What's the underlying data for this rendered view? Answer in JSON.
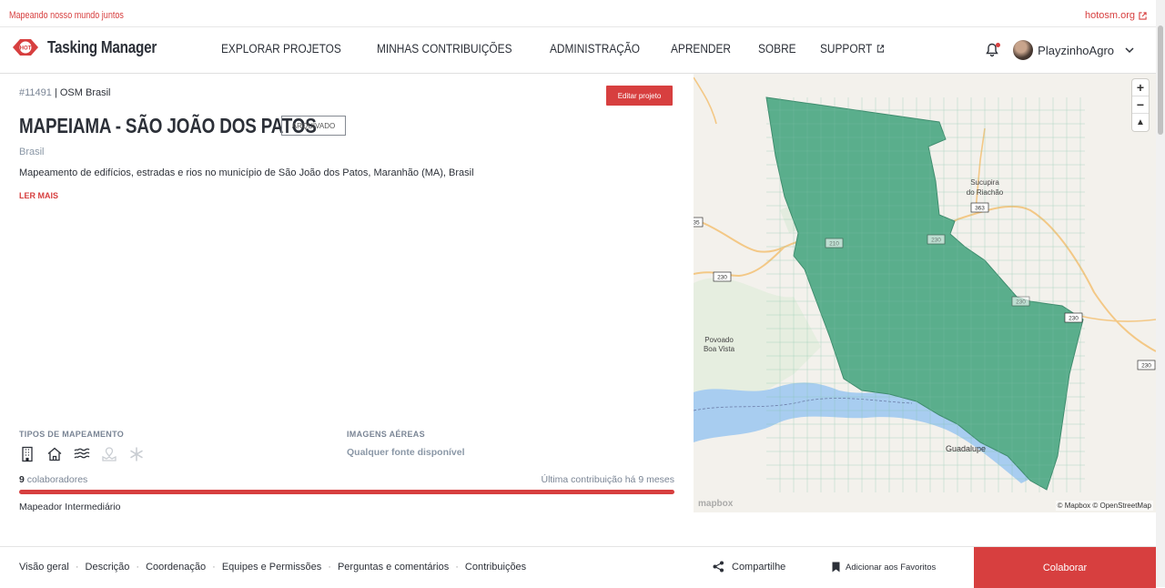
{
  "topbar": {
    "tagline": "Mapeando nosso mundo juntos",
    "org_link": "hotosm.org"
  },
  "header": {
    "logo_text": "Tasking Manager",
    "logo_badge": "HOT",
    "nav": [
      {
        "label": "EXPLORAR PROJETOS"
      },
      {
        "label": "MINHAS CONTRIBUIÇÕES"
      },
      {
        "label": "ADMINISTRAÇÃO"
      },
      {
        "label": "APRENDER"
      },
      {
        "label": "SOBRE"
      },
      {
        "label": "SUPPORT"
      }
    ],
    "username": "PlayzinhoAgro"
  },
  "project": {
    "id": "#11491",
    "org": "| OSM Brasil",
    "edit_label": "Editar projeto",
    "title": "MAPEIAMA - SÃO JOÃO DOS PATOS",
    "status_badge": "ARQUIVADO",
    "country": "Brasil",
    "description": "Mapeamento de edifícios, estradas e rios no município de São João dos Patos, Maranhão (MA), Brasil",
    "read_more": "LER MAIS",
    "types_label": "TIPOS DE MAPEAMENTO",
    "types_icons": [
      "buildings-icon",
      "house-icon",
      "waterways-icon",
      "land-use-icon",
      "other-icon"
    ],
    "imagery_label": "IMAGENS AÉREAS",
    "imagery_value": "Qualquer fonte disponível",
    "contributors_count": "9",
    "contributors_label": " colaboradores",
    "last_contribution": "Última contribuição há 9 meses",
    "level": "Mapeador Intermediário"
  },
  "map": {
    "places": [
      {
        "label": "Sucupira"
      },
      {
        "label": "do Riachão"
      },
      {
        "label": "Povoado"
      },
      {
        "label": "Boa Vista"
      },
      {
        "label": "Guadalupe"
      }
    ],
    "shields": [
      "363",
      "230",
      "230",
      "230",
      "230",
      "210",
      "230",
      "35"
    ],
    "attribution": "© Mapbox © OpenStreetMap",
    "logo": "mapbox",
    "zoom_in": "+",
    "zoom_out": "−",
    "compass": "▲"
  },
  "footer": {
    "tabs": [
      {
        "label": "Visão geral"
      },
      {
        "label": "Descrição"
      },
      {
        "label": "Coordenação"
      },
      {
        "label": "Equipes e Permissões"
      },
      {
        "label": "Perguntas e comentários"
      },
      {
        "label": "Contribuições"
      }
    ],
    "separator": "·",
    "share": "Compartilhe",
    "favorite": "Adicionar aos Favoritos",
    "collaborate": "Colaborar"
  },
  "colors": {
    "accent": "#d73f3f",
    "aoi_fill": "#5aae8c",
    "water": "#a8cdf0"
  }
}
